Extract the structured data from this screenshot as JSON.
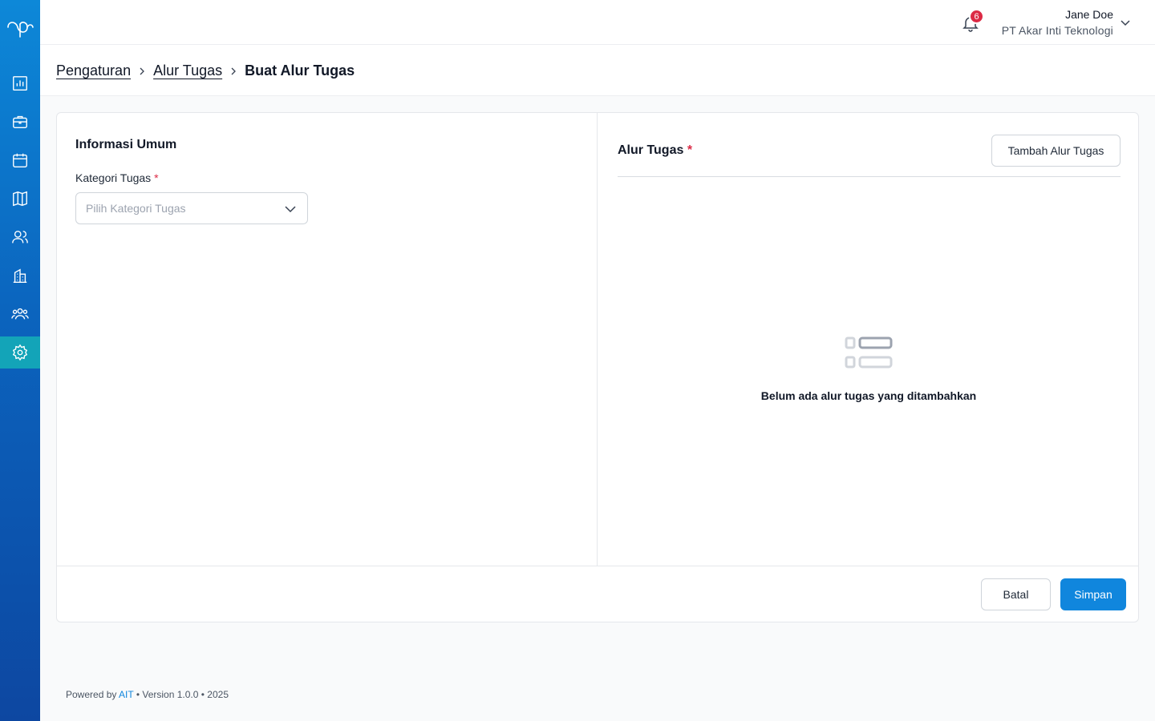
{
  "header": {
    "notification_count": "6",
    "user_name": "Jane Doe",
    "company": "PT Akar Inti Teknologi"
  },
  "sidebar": {
    "items": [
      {
        "icon": "chart-icon"
      },
      {
        "icon": "briefcase-icon"
      },
      {
        "icon": "calendar-icon"
      },
      {
        "icon": "map-icon"
      },
      {
        "icon": "users-icon"
      },
      {
        "icon": "building-icon"
      },
      {
        "icon": "team-icon"
      },
      {
        "icon": "settings-icon",
        "active": true
      }
    ]
  },
  "breadcrumb": {
    "items": [
      "Pengaturan",
      "Alur Tugas"
    ],
    "current": "Buat Alur Tugas"
  },
  "general_info": {
    "title": "Informasi Umum",
    "category_label": "Kategori Tugas",
    "required_mark": "*",
    "category_placeholder": "Pilih Kategori Tugas"
  },
  "workflow": {
    "title": "Alur Tugas",
    "required_mark": "*",
    "add_button": "Tambah Alur Tugas",
    "empty_message": "Belum ada alur tugas yang ditambahkan"
  },
  "actions": {
    "cancel": "Batal",
    "save": "Simpan"
  },
  "footer": {
    "powered_by": "Powered by",
    "brand": "AIT",
    "version_text": "• Version 1.0.0 • 2025"
  },
  "colors": {
    "primary": "#1086dd",
    "sidebar_active": "#13a4b8",
    "danger": "#dc2a45"
  }
}
